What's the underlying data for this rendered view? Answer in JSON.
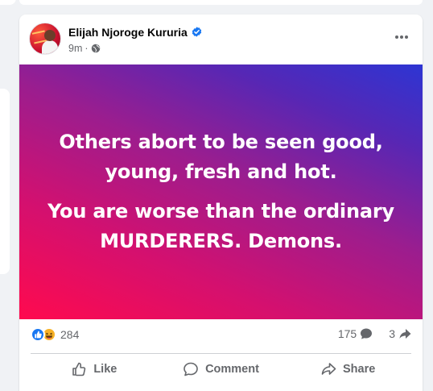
{
  "post": {
    "author": "Elijah Njoroge Kururia",
    "time": "9m",
    "separator": "·",
    "text_lines": [
      "Others abort to be seen good, young, fresh and hot.",
      "You are worse than the ordinary MURDERERS. Demons."
    ],
    "background_gradient": [
      "#ff0a4e",
      "#9c1d8e",
      "#2d35d3"
    ]
  },
  "stats": {
    "reaction_count": "284",
    "comments": "175",
    "shares": "3"
  },
  "actions": {
    "like": "Like",
    "comment": "Comment",
    "share": "Share"
  },
  "icons": [
    "verified-badge",
    "globe",
    "more-options",
    "like-reaction",
    "haha-reaction",
    "comment",
    "share",
    "like-thumb"
  ],
  "colors": {
    "accent": "#1877f2",
    "secondary_text": "#65676b"
  }
}
